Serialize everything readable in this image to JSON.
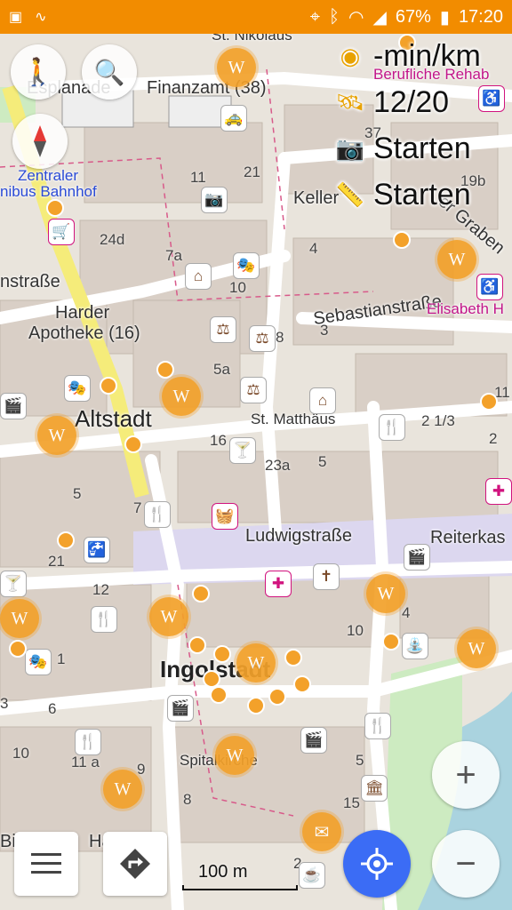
{
  "status_bar": {
    "battery": "67%",
    "time": "17:20"
  },
  "overlay": {
    "speed": "-min/km",
    "gps": "12/20",
    "photo_label": "Starten",
    "ruler_label": "Starten"
  },
  "map_labels": {
    "st_nikolaus": "St. Nikolaus",
    "esplanade": "Esplanade",
    "finanzamt": "Finanzamt (38)",
    "beruflische": "Berufliche Rehab",
    "zentraler": "Zentraler",
    "omnibus": "nibus Bahnhof",
    "kelle": "Keller",
    "graben": "er Graben",
    "strasse_left": "nstraße",
    "harder": "Harder",
    "apotheke": "Apotheke (16)",
    "sebastian": "Sebastianstraße",
    "elisabeth": "Elisabeth H",
    "altstadt": "Altstadt",
    "matthaus": "St. Matthäus",
    "ludwig": "Ludwigstraße",
    "reiterka": "Reiterkas",
    "ingolstadt": "Ingolstadt",
    "spital": "Spitalkirche",
    "bi": "Bi",
    "ha": "Hä"
  },
  "house_numbers": [
    "37",
    "21",
    "11",
    "19b",
    "24d",
    "7a",
    "4",
    "10",
    "8",
    "3",
    "5a",
    "16",
    "23a",
    "5",
    "2 1/3",
    "2",
    "11",
    "5",
    "7",
    "21",
    "12",
    "10",
    "4",
    "6",
    "3",
    "1",
    "11 a",
    "9",
    "10",
    "8",
    "5",
    "15",
    "2"
  ],
  "scale": "100 m",
  "icons": {
    "menu": "menu-icon",
    "route": "route-icon",
    "locate": "my-location-icon",
    "zoom_in": "plus-icon",
    "zoom_out": "minus-icon",
    "walk": "pedestrian-icon",
    "search": "search-icon",
    "compass": "compass-icon"
  },
  "colors": {
    "status_bar": "#f28c00",
    "wiki": "#f3a12a",
    "locate_button": "#3b6cf5"
  }
}
